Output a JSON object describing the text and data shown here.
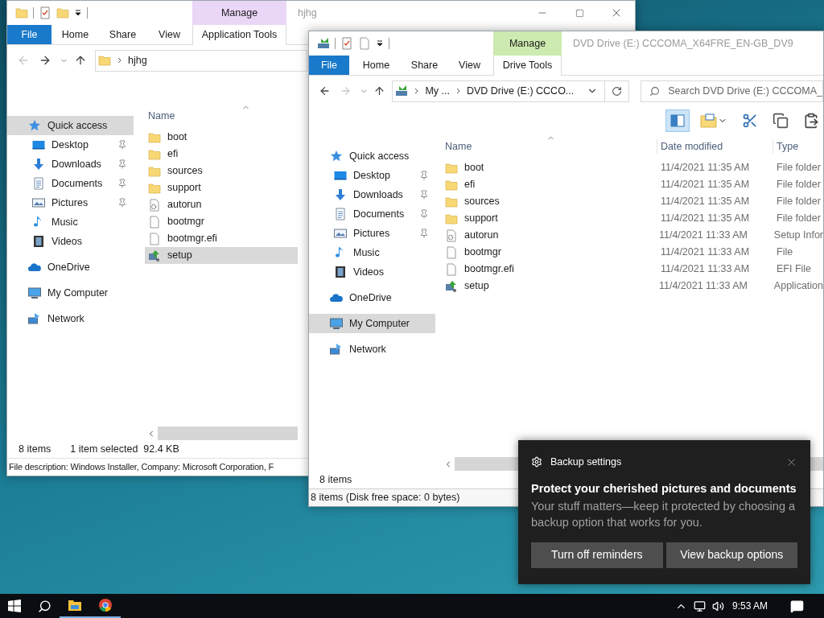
{
  "windows": [
    {
      "title": "hjhg",
      "window_controls": true,
      "context_group": {
        "label": "Manage",
        "color": "#ead6f7"
      },
      "ribbon_tabs": [
        {
          "label": "File",
          "kind": "file"
        },
        {
          "label": "Home",
          "kind": "tab"
        },
        {
          "label": "Share",
          "kind": "tab"
        },
        {
          "label": "View",
          "kind": "tab"
        },
        {
          "label": "Application Tools",
          "kind": "context"
        }
      ],
      "breadcrumb": [
        "hjhg"
      ],
      "nav": [
        {
          "label": "Quick access",
          "kind": "quick-access",
          "selected": true,
          "children": [
            {
              "label": "Desktop",
              "kind": "desktop",
              "pinned": true,
              "selected": false
            },
            {
              "label": "Downloads",
              "kind": "downloads",
              "pinned": true,
              "selected": false
            },
            {
              "label": "Documents",
              "kind": "documents",
              "pinned": true,
              "selected": false
            },
            {
              "label": "Pictures",
              "kind": "pictures",
              "pinned": true,
              "selected": false
            },
            {
              "label": "Music",
              "kind": "music",
              "pinned": false,
              "selected": false
            },
            {
              "label": "Videos",
              "kind": "videos",
              "pinned": false,
              "selected": false
            }
          ]
        },
        {
          "label": "OneDrive",
          "kind": "onedrive",
          "selected": false
        },
        {
          "label": "My Computer",
          "kind": "computer",
          "selected": false
        },
        {
          "label": "Network",
          "kind": "network",
          "selected": false
        }
      ],
      "columns": [
        "Name"
      ],
      "files": [
        {
          "name": "boot",
          "kind": "folder",
          "selected": false
        },
        {
          "name": "efi",
          "kind": "folder",
          "selected": false
        },
        {
          "name": "sources",
          "kind": "folder",
          "selected": false
        },
        {
          "name": "support",
          "kind": "folder",
          "selected": false
        },
        {
          "name": "autorun",
          "kind": "settings-file",
          "selected": false
        },
        {
          "name": "bootmgr",
          "kind": "file",
          "selected": false
        },
        {
          "name": "bootmgr.efi",
          "kind": "file",
          "selected": false
        },
        {
          "name": "setup",
          "kind": "installer",
          "selected": true
        }
      ],
      "status": [
        "8 items",
        "1 item selected  92.4 KB"
      ],
      "details": "File description: Windows Installer, Company: Microsoft Corporation, F"
    },
    {
      "title": "DVD Drive (E:) CCCOMA_X64FRE_EN-GB_DV9",
      "window_controls": false,
      "context_group": {
        "label": "Manage",
        "color": "#cdeab0"
      },
      "ribbon_tabs": [
        {
          "label": "File",
          "kind": "file"
        },
        {
          "label": "Home",
          "kind": "tab"
        },
        {
          "label": "Share",
          "kind": "tab"
        },
        {
          "label": "View",
          "kind": "tab"
        },
        {
          "label": "Drive Tools",
          "kind": "context"
        }
      ],
      "breadcrumb": [
        "My ...",
        "DVD Drive (E:) CCCO..."
      ],
      "search": {
        "placeholder": "Search DVD Drive (E:) CCCOMA_"
      },
      "toolbar": [
        {
          "kind": "preview-pane",
          "selected": true
        },
        {
          "kind": "new-folder",
          "selected": false
        },
        {
          "kind": "cut",
          "selected": false
        },
        {
          "kind": "copy",
          "selected": false
        },
        {
          "kind": "paste",
          "selected": false
        }
      ],
      "nav": [
        {
          "label": "Quick access",
          "kind": "quick-access",
          "selected": false,
          "children": [
            {
              "label": "Desktop",
              "kind": "desktop",
              "pinned": true,
              "selected": false
            },
            {
              "label": "Downloads",
              "kind": "downloads",
              "pinned": true,
              "selected": false
            },
            {
              "label": "Documents",
              "kind": "documents",
              "pinned": true,
              "selected": false
            },
            {
              "label": "Pictures",
              "kind": "pictures",
              "pinned": true,
              "selected": false
            },
            {
              "label": "Music",
              "kind": "music",
              "pinned": false,
              "selected": false
            },
            {
              "label": "Videos",
              "kind": "videos",
              "pinned": false,
              "selected": false
            }
          ]
        },
        {
          "label": "OneDrive",
          "kind": "onedrive",
          "selected": false
        },
        {
          "label": "My Computer",
          "kind": "computer",
          "selected": true
        },
        {
          "label": "Network",
          "kind": "network",
          "selected": false
        }
      ],
      "columns": [
        "Name",
        "Date modified",
        "Type"
      ],
      "files": [
        {
          "name": "boot",
          "kind": "folder",
          "date": "11/4/2021 11:35 AM",
          "type": "File folder",
          "selected": false
        },
        {
          "name": "efi",
          "kind": "folder",
          "date": "11/4/2021 11:35 AM",
          "type": "File folder",
          "selected": false
        },
        {
          "name": "sources",
          "kind": "folder",
          "date": "11/4/2021 11:35 AM",
          "type": "File folder",
          "selected": false
        },
        {
          "name": "support",
          "kind": "folder",
          "date": "11/4/2021 11:35 AM",
          "type": "File folder",
          "selected": false
        },
        {
          "name": "autorun",
          "kind": "settings-file",
          "date": "11/4/2021 11:33 AM",
          "type": "Setup Infor",
          "selected": false
        },
        {
          "name": "bootmgr",
          "kind": "file",
          "date": "11/4/2021 11:33 AM",
          "type": "File",
          "selected": false
        },
        {
          "name": "bootmgr.efi",
          "kind": "file",
          "date": "11/4/2021 11:33 AM",
          "type": "EFI File",
          "selected": false
        },
        {
          "name": "setup",
          "kind": "installer",
          "date": "11/4/2021 11:33 AM",
          "type": "Application",
          "selected": false
        }
      ],
      "status": [
        "8 items"
      ],
      "footer": "8 items (Disk free space: 0 bytes)"
    }
  ],
  "toast": {
    "app": "Backup settings",
    "heading": "Protect your cherished pictures and documents",
    "body": "Your stuff matters—keep it protected by choosing a backup option that works for you.",
    "buttons": [
      "Turn off reminders",
      "View backup options"
    ]
  },
  "taskbar": {
    "apps": [
      {
        "kind": "explorer",
        "running": true
      },
      {
        "kind": "chrome",
        "running": true
      }
    ],
    "time": "9:53 AM"
  }
}
